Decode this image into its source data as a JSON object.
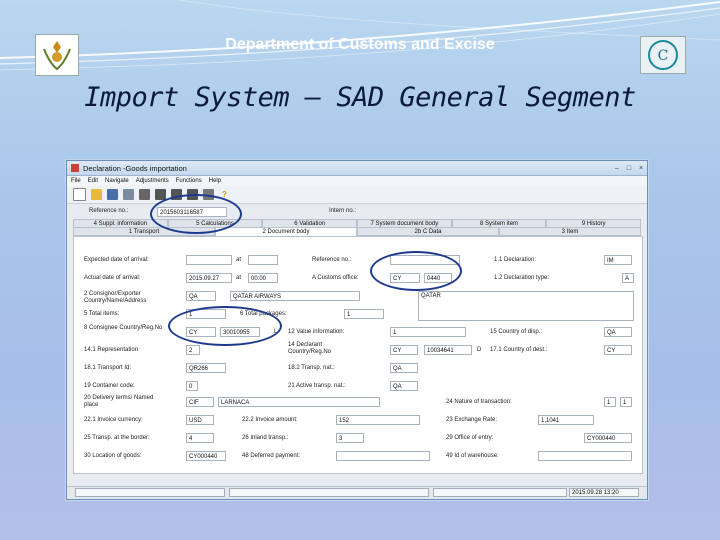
{
  "slide": {
    "department": "Department of Customs and Excise",
    "title": "Import System – SAD General Segment"
  },
  "window": {
    "title": "Declaration -Goods importation",
    "menu": [
      "File",
      "Edit",
      "Navigate",
      "Adjustments",
      "Functions",
      "Help"
    ],
    "reference_label": "Reference no.:",
    "reference_value": "2015603116587",
    "intern_label": "Intern no.:",
    "tabs_top": [
      "4 Suppl. information",
      "5 Calculations",
      "6 Validation",
      "7 System document body",
      "8 System item",
      "9 History"
    ],
    "tabs_bottom": [
      "1 Transport",
      "2 Document body",
      "2b C Data",
      "3 Item"
    ],
    "active_tab": "2 Document body",
    "status_datetime": "2015.09.28 13:20"
  },
  "form": {
    "expected_arrival_label": "Expected date of arrival:",
    "at_label": "at",
    "actual_arrival_label": "Actual date of arrival:",
    "actual_arrival_date": "2015.09.27",
    "actual_arrival_time": "00:00",
    "reference_no_label": "Reference no.:",
    "declaration_label": "1.1 Declaration:",
    "declaration_value": "IM",
    "customs_office_label": "A Customs office:",
    "customs_office_country": "CY",
    "customs_office_code": "0440",
    "declaration_type_label": "1.2 Declaration type:",
    "declaration_type_value": "A",
    "consignor_label": "2 Consignor/Exporter Country/Name/Address",
    "consignor_country": "QA",
    "consignor_name": "QATAR AIRWAYS",
    "consignor_address": "QATAR",
    "total_items_label": "5 Total items:",
    "total_items_value": "1",
    "total_packages_label": "6 Total packages:",
    "total_packages_value": "1",
    "consignee_label": "8 Consignee Country/Reg.No",
    "consignee_country": "CY",
    "consignee_regno": "30010955",
    "consignee_suffix": "L",
    "value_info_label": "12 Value information:",
    "value_info_value": "1",
    "country_disp_label": "15 Country of disp.:",
    "country_disp_value": "QA",
    "representation_label": "14.1 Representation",
    "representation_value": "2",
    "declarant_label": "14 Declarant Country/Reg.No",
    "declarant_country": "CY",
    "declarant_regno": "10034641",
    "declarant_suffix": "D",
    "country_dest_label": "17.1 Country of dest.:",
    "country_dest_value": "CY",
    "transport_id_label": "18.1 Transport Id:",
    "transport_id_value": "QR266",
    "transport_nat_label": "18.2 Transp. nat.:",
    "transport_nat_value": "QA",
    "container_label": "19 Container code:",
    "container_value": "0",
    "active_transp_label": "21 Active transp. nat.:",
    "active_transp_value": "QA",
    "delivery_terms_label": "20 Delivery terms/ Named place",
    "delivery_terms_code": "CIF",
    "delivery_terms_place": "LARNACA",
    "nature_label": "24 Nature of transaction:",
    "nature_value_1": "1",
    "nature_value_2": "1",
    "invoice_currency_label": "22.1 Invoice currency:",
    "invoice_currency_value": "USD",
    "invoice_amount_label": "22.2 Invoice amount:",
    "invoice_amount_value": "152",
    "exchange_rate_label": "23 Exchange Rate:",
    "exchange_rate_value": "1,1041",
    "transp_border_label": "25 Transp. at the border:",
    "transp_border_value": "4",
    "inland_transp_label": "26 Inland transp.:",
    "inland_transp_value": "3",
    "office_entry_label": "29 Office of entry:",
    "office_entry_value": "CY000440",
    "location_goods_label": "30 Location of goods:",
    "location_goods_value": "CY000440",
    "deferred_payment_label": "48 Deferred payment:",
    "warehouse_label": "49 Id of warehouse:"
  },
  "colors": {
    "highlight_oval": "#1d3a8f",
    "window_border": "#6a8fb8"
  }
}
